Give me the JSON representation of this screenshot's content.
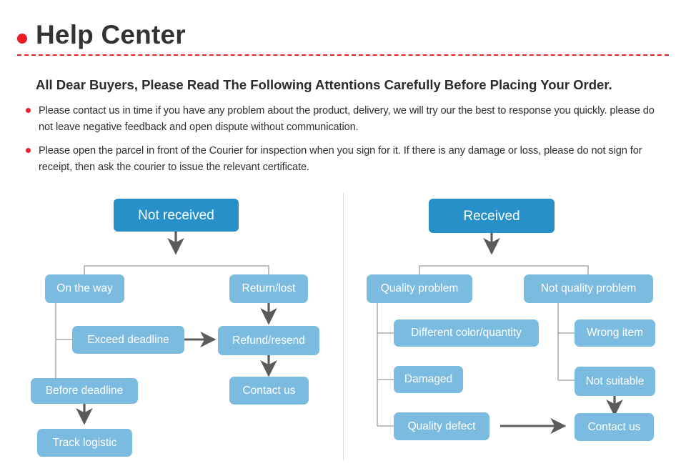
{
  "header": {
    "title": "Help Center",
    "dot_icon": "bullet-dot-icon",
    "accent_color": "#ee2026",
    "rule_style": "dashed"
  },
  "intro": {
    "heading": "All Dear Buyers, Please Read The Following Attentions Carefully Before Placing Your Order.",
    "notes": [
      "Please contact us in time if you have any problem about the product, delivery, we will try our the best to response you quickly. please do not leave negative feedback and open dispute without communication.",
      "Please open the parcel in front of the Courier for inspection when you sign for it. If there is any damage or loss, please do not sign for receipt, then ask the courier to issue the relevant certificate."
    ],
    "bullet_icon": "bullet-dot-icon"
  },
  "colors": {
    "node_primary": "#2790c9",
    "node_secondary": "#7bbbdf",
    "arrow": "#5b5b5b",
    "connector": "#9b9b9b",
    "divider": "#dcdcdc",
    "accent_red": "#ee2026"
  },
  "flowcharts": [
    {
      "id": "not-received",
      "root": "Not received",
      "nodes": [
        "On the way",
        "Return/lost",
        "Exceed deadline",
        "Refund/resend",
        "Before deadline",
        "Contact us",
        "Track logistic"
      ]
    },
    {
      "id": "received",
      "root": "Received",
      "nodes": [
        "Quality problem",
        "Not quality problem",
        "Different color/quantity",
        "Wrong item",
        "Damaged",
        "Not suitable",
        "Quality defect",
        "Contact us"
      ]
    }
  ]
}
